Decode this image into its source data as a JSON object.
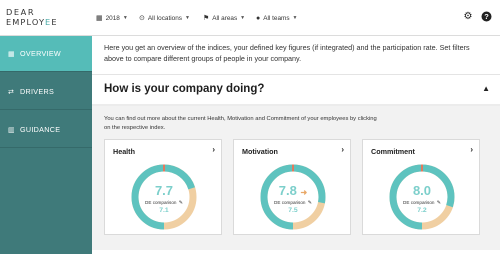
{
  "brand": {
    "line1": "DEAR",
    "line2_pre": "EMPLOY",
    "line2_accent": "E",
    "line2_post": "E"
  },
  "filters": [
    {
      "icon": "calendar-icon",
      "label": "2018"
    },
    {
      "icon": "location-icon",
      "label": "All locations"
    },
    {
      "icon": "flag-icon",
      "label": "All areas"
    },
    {
      "icon": "person-icon",
      "label": "All teams"
    }
  ],
  "header_icons": [
    "gear-icon",
    "help-icon"
  ],
  "sidebar": {
    "items": [
      {
        "label": "OVERVIEW",
        "icon": "grid-icon",
        "active": true
      },
      {
        "label": "DRIVERS",
        "icon": "arrows-icon",
        "active": false
      },
      {
        "label": "GUIDANCE",
        "icon": "book-icon",
        "active": false
      }
    ]
  },
  "intro_text": "Here you get an overview of the indices, your defined key figures (if integrated) and the participation rate. Set filters above to compare different groups of people in your company.",
  "section": {
    "title": "How is your company doing?",
    "description": "You can find out more about the current Health, Motivation and Commitment of your employees by clicking on the respective index."
  },
  "cards": [
    {
      "title": "Health",
      "score": "7.7",
      "trend": "",
      "comparison_label": "DE comparison",
      "comparison_value": "7.1",
      "share": 0.7,
      "accent": "#f0cfa2",
      "marker": "#e07a5f"
    },
    {
      "title": "Motivation",
      "score": "7.8",
      "trend": "➜",
      "comparison_label": "DE comparison",
      "comparison_value": "7.5",
      "share": 0.78,
      "accent": "#f0cfa2",
      "marker": "#e07a5f"
    },
    {
      "title": "Commitment",
      "score": "8.0",
      "trend": "",
      "comparison_label": "DE comparison",
      "comparison_value": "7.2",
      "share": 0.8,
      "accent": "#f0cfa2",
      "marker": "#e07a5f"
    }
  ],
  "colors": {
    "teal": "#55bcb8",
    "sidebar": "#3f7a7a",
    "donut_track": "#f0cfa2",
    "donut_value": "#5ec3bf"
  }
}
